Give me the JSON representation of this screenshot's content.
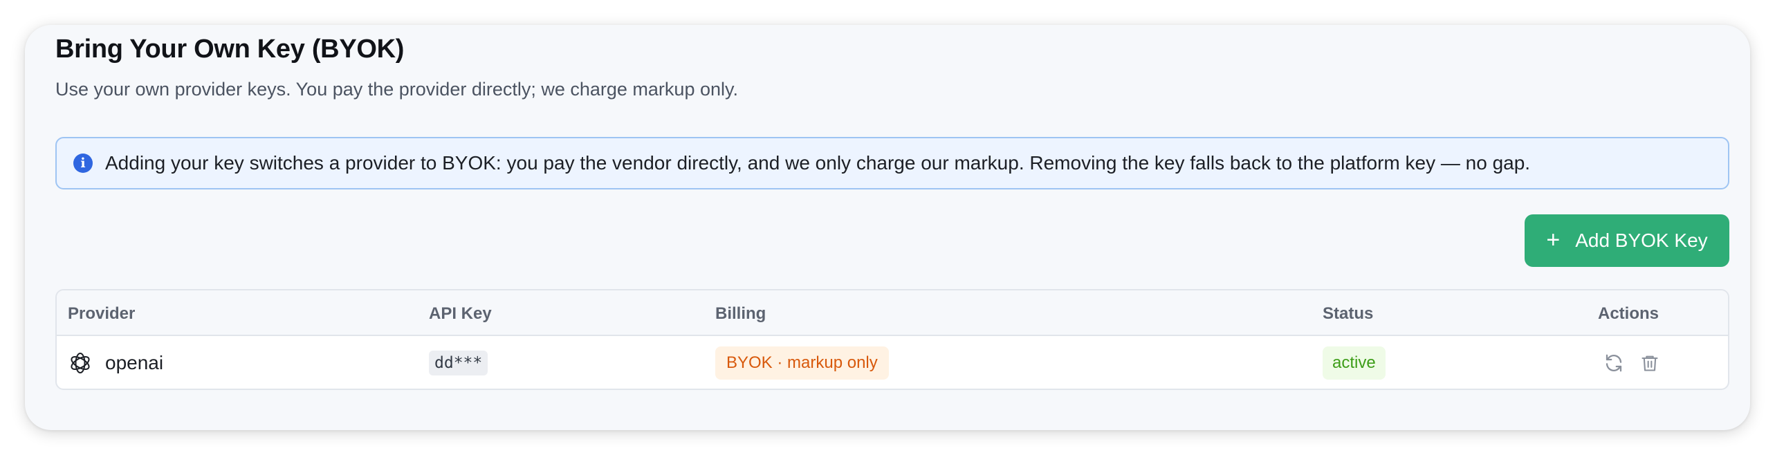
{
  "header": {
    "title": "Bring Your Own Key (BYOK)",
    "subtitle": "Use your own provider keys. You pay the provider directly; we charge markup only."
  },
  "info_banner": {
    "icon": "info-icon",
    "text": "Adding your key switches a provider to BYOK: you pay the vendor directly, and we only charge our markup. Removing the key falls back to the platform key — no gap."
  },
  "toolbar": {
    "add_label": "Add BYOK Key",
    "add_icon": "plus-icon"
  },
  "table": {
    "columns": [
      "Provider",
      "API Key",
      "Billing",
      "Status",
      "Actions"
    ],
    "rows": [
      {
        "provider": "openai",
        "provider_icon": "openai-logo-icon",
        "api_key": "dd***",
        "billing": "BYOK · markup only",
        "status": "active",
        "actions": [
          "refresh-icon",
          "trash-icon"
        ]
      }
    ]
  },
  "colors": {
    "accent": "#2fad77",
    "info_bg": "#edf4ff",
    "info_border": "#9ec4f3",
    "info_icon": "#2f66e0",
    "billing_text": "#d8590c",
    "billing_bg": "#fff2e3",
    "status_text": "#3d9d18",
    "status_bg": "#effbe7"
  }
}
